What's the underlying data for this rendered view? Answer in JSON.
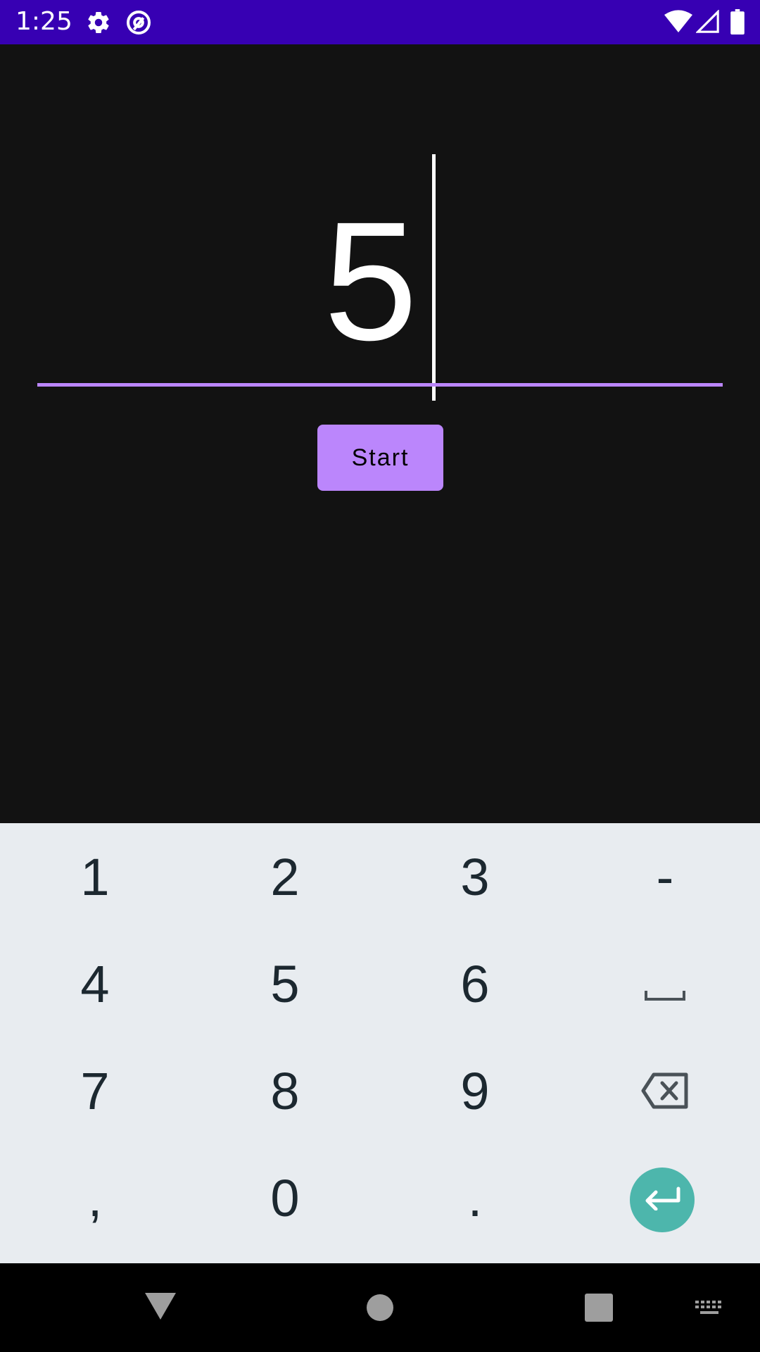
{
  "status_bar": {
    "time": "1:25",
    "icons": [
      "gear-icon",
      "at-sign-icon",
      "wifi-icon",
      "signal-icon",
      "battery-icon"
    ]
  },
  "app": {
    "number_value": "5",
    "start_label": "Start",
    "accent_color": "#bb86fc"
  },
  "keyboard": {
    "rows": [
      [
        "1",
        "2",
        "3",
        "-"
      ],
      [
        "4",
        "5",
        "6",
        "space"
      ],
      [
        "7",
        "8",
        "9",
        "backspace"
      ],
      [
        ",",
        "0",
        ".",
        "enter"
      ]
    ],
    "enter_color": "#4db6ac"
  },
  "nav_bar": {
    "buttons": [
      "back",
      "home",
      "recents",
      "keyboard-switch"
    ]
  }
}
